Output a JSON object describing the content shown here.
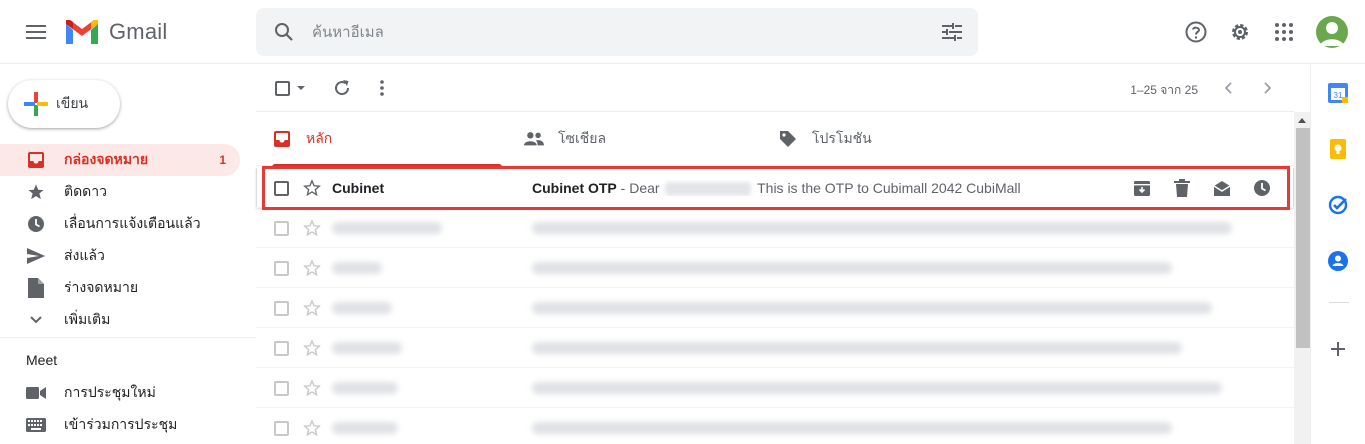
{
  "header": {
    "app_name": "Gmail",
    "search_placeholder": "ค้นหาอีเมล"
  },
  "nav": {
    "compose_label": "เขียน",
    "items": [
      {
        "label": "กล่องจดหมาย",
        "count": "1",
        "icon": "inbox-icon",
        "active": true
      },
      {
        "label": "ติดดาว",
        "count": "",
        "icon": "star-icon"
      },
      {
        "label": "เลื่อนการแจ้งเตือนแล้ว",
        "count": "",
        "icon": "clock-icon"
      },
      {
        "label": "ส่งแล้ว",
        "count": "",
        "icon": "send-icon"
      },
      {
        "label": "ร่างจดหมาย",
        "count": "",
        "icon": "draft-icon"
      },
      {
        "label": "เพิ่มเติม",
        "count": "",
        "icon": "chevron-down-icon"
      }
    ],
    "meet_title": "Meet",
    "meet_items": [
      {
        "label": "การประชุมใหม่",
        "icon": "video-icon"
      },
      {
        "label": "เข้าร่วมการประชุม",
        "icon": "keyboard-icon"
      }
    ]
  },
  "toolbar": {
    "pagination": "1–25 จาก 25"
  },
  "tabs": [
    {
      "label": "หลัก",
      "icon": "inbox-icon",
      "active": true
    },
    {
      "label": "โซเชียล",
      "icon": "people-icon"
    },
    {
      "label": "โปรโมชัน",
      "icon": "tag-icon"
    }
  ],
  "emails": [
    {
      "sender": "Cubinet",
      "subject": "Cubinet OTP",
      "snippet_prefix": " - Dear ",
      "snippet_suffix": " This is the OTP to Cubimall 2042 CubiMall"
    }
  ],
  "colors": {
    "accent_red": "#d93025",
    "highlight_border": "#e53935",
    "active_nav_bg": "#fce8e6"
  }
}
